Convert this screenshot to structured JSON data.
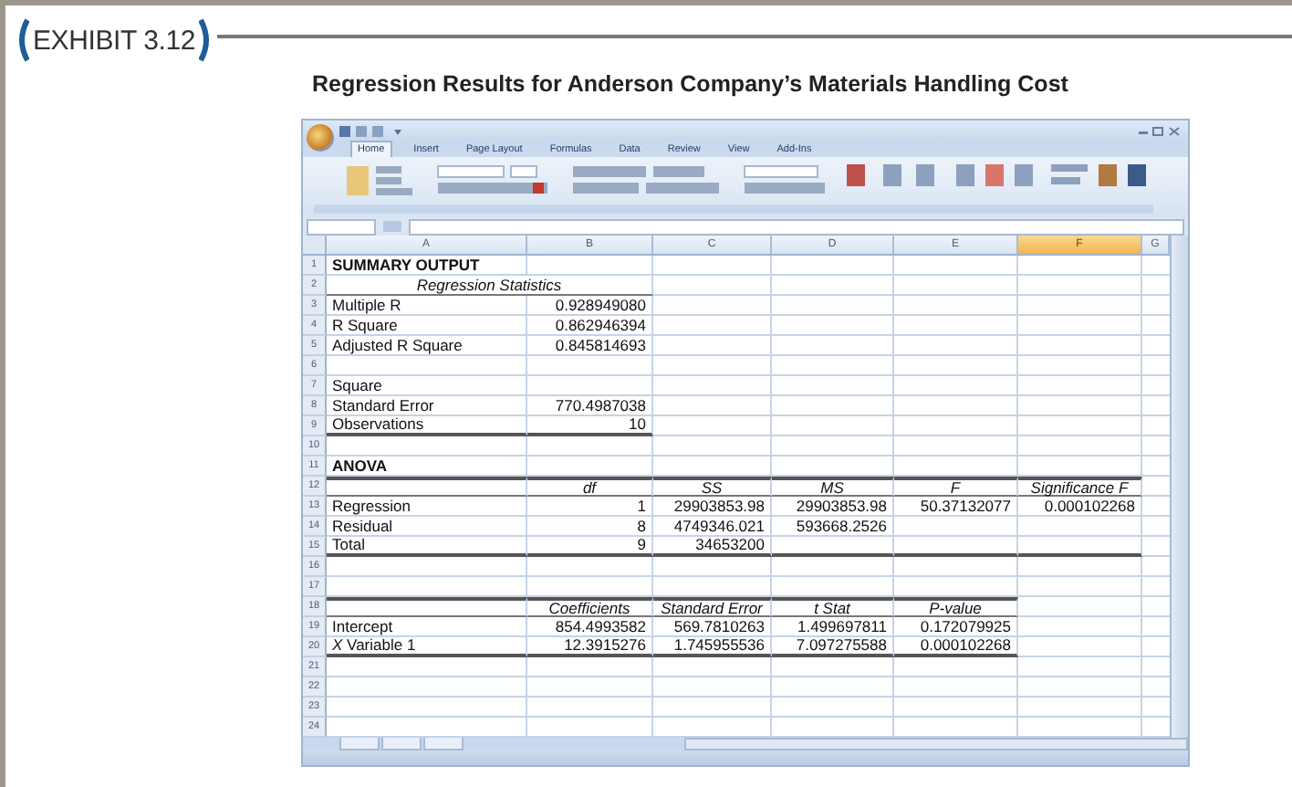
{
  "exhibit": {
    "label": "EXHIBIT 3.12",
    "title": "Regression Results for Anderson Company’s Materials Handling Cost"
  },
  "excel": {
    "tabs": [
      {
        "label": "Home",
        "selected": true
      },
      {
        "label": "Insert",
        "selected": false
      },
      {
        "label": "Page Layout",
        "selected": false
      },
      {
        "label": "Formulas",
        "selected": false
      },
      {
        "label": "Data",
        "selected": false
      },
      {
        "label": "Review",
        "selected": false
      },
      {
        "label": "View",
        "selected": false
      },
      {
        "label": "Add-Ins",
        "selected": false
      }
    ],
    "columns": [
      {
        "label": "A",
        "selected": false
      },
      {
        "label": "B",
        "selected": false
      },
      {
        "label": "C",
        "selected": false
      },
      {
        "label": "D",
        "selected": false
      },
      {
        "label": "E",
        "selected": false
      },
      {
        "label": "F",
        "selected": true
      },
      {
        "label": "G",
        "selected": false
      }
    ],
    "rows": [
      {
        "num": "1",
        "kind": "title",
        "cells": [
          "SUMMARY OUTPUT"
        ]
      },
      {
        "num": "2",
        "kind": "caption",
        "cells": [
          "Regression Statistics"
        ]
      },
      {
        "num": "3",
        "kind": "data",
        "cells": [
          "Multiple R",
          "0.928949080"
        ]
      },
      {
        "num": "4",
        "kind": "data",
        "cells": [
          "R Square",
          "0.862946394"
        ]
      },
      {
        "num": "5",
        "kind": "data",
        "cells": [
          "Adjusted R Square",
          "0.845814693"
        ]
      },
      {
        "num": "6",
        "kind": "blank"
      },
      {
        "num": "7",
        "kind": "data",
        "cells": [
          "Square"
        ]
      },
      {
        "num": "8",
        "kind": "data",
        "cells": [
          "Standard Error",
          "770.4987038"
        ]
      },
      {
        "num": "9",
        "kind": "last",
        "cells": [
          "Observations",
          "10"
        ]
      },
      {
        "num": "10",
        "kind": "blank"
      },
      {
        "num": "11",
        "kind": "title",
        "cells": [
          "ANOVA"
        ]
      },
      {
        "num": "12",
        "kind": "head",
        "cells": [
          null,
          "df",
          "SS",
          "MS",
          "F",
          "Significance F"
        ]
      },
      {
        "num": "13",
        "kind": "data",
        "cells": [
          "Regression",
          "1",
          "29903853.98",
          "29903853.98",
          "50.37132077",
          "0.000102268"
        ]
      },
      {
        "num": "14",
        "kind": "data",
        "cells": [
          "Residual",
          "8",
          "4749346.021",
          "593668.2526"
        ]
      },
      {
        "num": "15",
        "kind": "last",
        "cells": [
          "Total",
          "9",
          "34653200",
          null,
          null,
          null
        ]
      },
      {
        "num": "16",
        "kind": "blank"
      },
      {
        "num": "17",
        "kind": "blank"
      },
      {
        "num": "18",
        "kind": "head",
        "cells": [
          null,
          "Coefficients",
          "Standard Error",
          "t Stat",
          "P-value"
        ]
      },
      {
        "num": "19",
        "kind": "data",
        "cells": [
          "Intercept",
          "854.4993582",
          "569.7810263",
          "1.499697811",
          "0.172079925"
        ]
      },
      {
        "num": "20",
        "kind": "last",
        "cells": [
          "*X* Variable 1",
          "12.3915276",
          "1.745955536",
          "7.097275588",
          "0.000102268"
        ]
      },
      {
        "num": "21",
        "kind": "blank"
      },
      {
        "num": "22",
        "kind": "blank"
      },
      {
        "num": "23",
        "kind": "blank"
      },
      {
        "num": "24",
        "kind": "blank"
      }
    ]
  }
}
